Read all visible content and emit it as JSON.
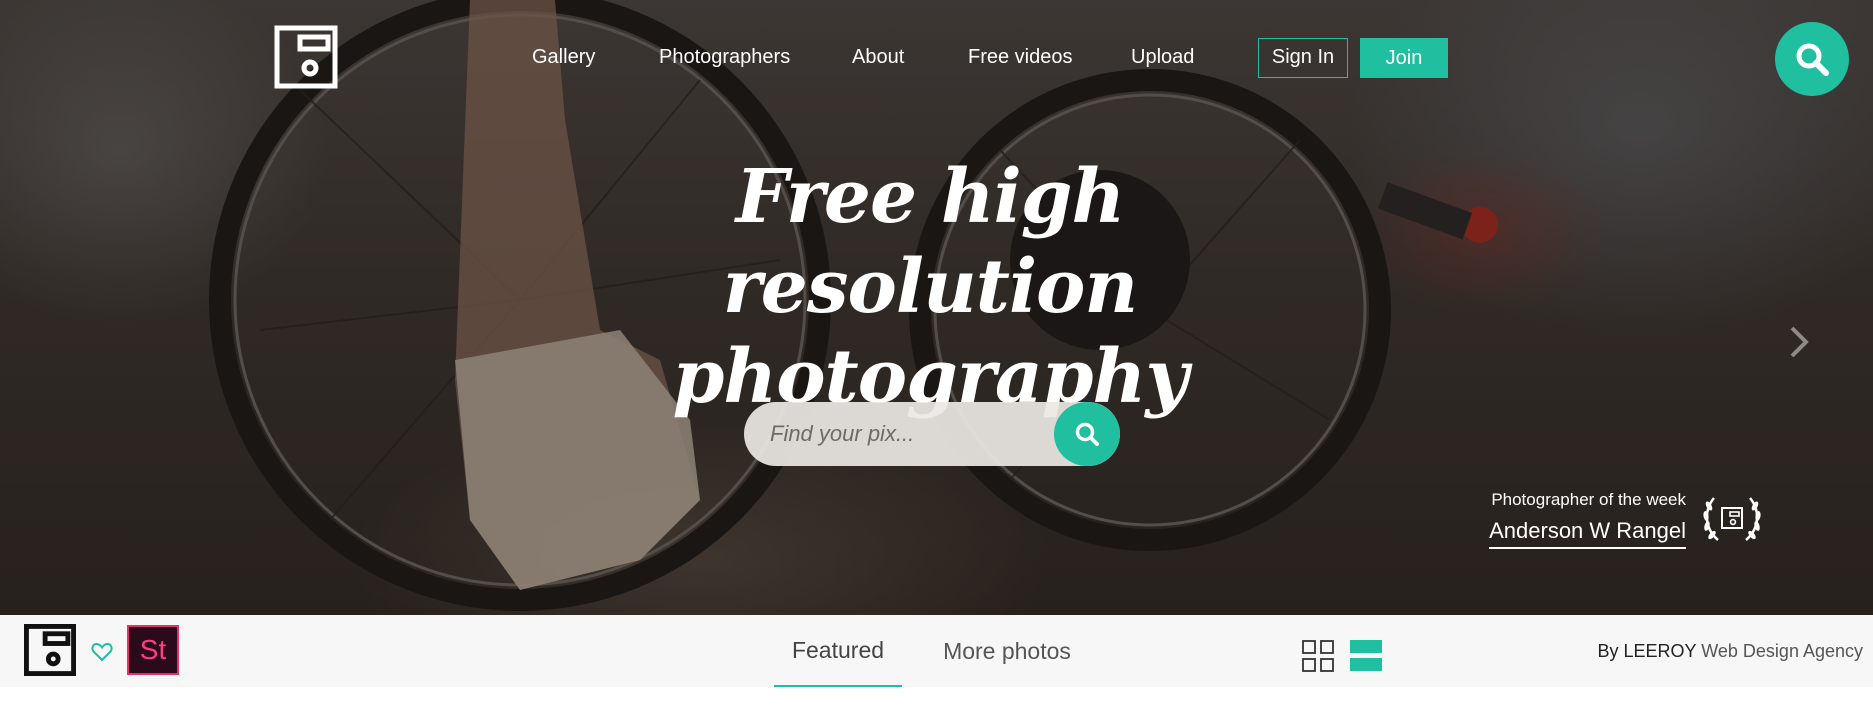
{
  "header": {
    "nav": [
      "Gallery",
      "Photographers",
      "About",
      "Free videos",
      "Upload"
    ],
    "sign_in": "Sign In",
    "join": "Join"
  },
  "hero": {
    "headline_line1": "Free high resolution",
    "headline_line2": "photography",
    "search_placeholder": "Find your pix...",
    "photographer_of_week_label": "Photographer of the week",
    "photographer_name": "Anderson W Rangel"
  },
  "bottom_bar": {
    "tabs": [
      "Featured",
      "More photos"
    ],
    "active_tab": "Featured",
    "stock_badge": "St",
    "credit_brand": "By LEEROY",
    "credit_rest": " Web Design Agency"
  },
  "colors": {
    "accent": "#1fbf9f",
    "stock_badge_text": "#ff3d7f"
  },
  "icons": [
    "logo-icon",
    "search-icon",
    "chevron-right-icon",
    "laurel-icon",
    "heart-icon",
    "grid-view-icon",
    "list-view-icon"
  ]
}
